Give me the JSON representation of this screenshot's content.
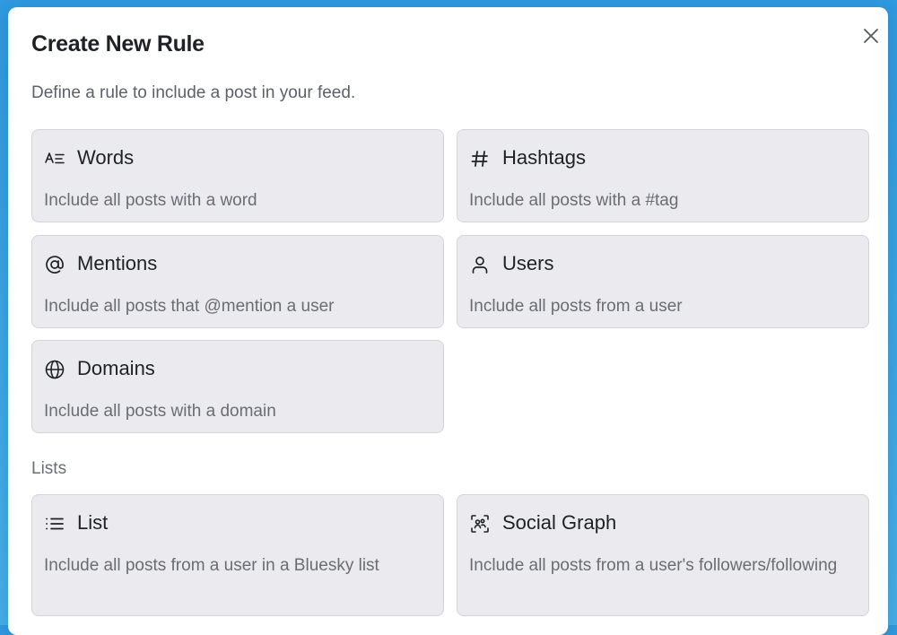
{
  "dialog": {
    "title": "Create New Rule",
    "subtitle": "Define a rule to include a post in your feed.",
    "close_icon": "close-icon"
  },
  "rules": [
    {
      "icon": "text-words-icon",
      "title": "Words",
      "description": "Include all posts with a word"
    },
    {
      "icon": "hashtag-icon",
      "title": "Hashtags",
      "description": "Include all posts with a #tag"
    },
    {
      "icon": "at-sign-icon",
      "title": "Mentions",
      "description": "Include all posts that @mention a user"
    },
    {
      "icon": "user-icon",
      "title": "Users",
      "description": "Include all posts from a user"
    },
    {
      "icon": "globe-icon",
      "title": "Domains",
      "description": "Include all posts with a domain"
    }
  ],
  "lists_section": {
    "label": "Lists",
    "items": [
      {
        "icon": "list-icon",
        "title": "List",
        "description": "Include all posts from a user in a Bluesky list"
      },
      {
        "icon": "social-graph-icon",
        "title": "Social Graph",
        "description": "Include all posts from a user's followers/following"
      }
    ]
  },
  "colors": {
    "background": "#3aa6e6",
    "card_background": "#ebeaee",
    "card_border": "#d4d3d9",
    "title_text": "#1e2126",
    "muted_text": "#6a6d74"
  }
}
